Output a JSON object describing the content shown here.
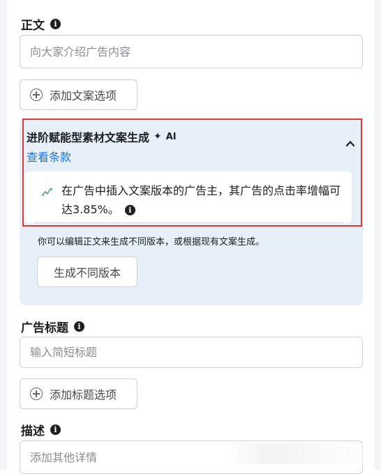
{
  "body_field": {
    "label": "正文",
    "placeholder": "向大家介绍广告内容",
    "add_option_label": "添加文案选项"
  },
  "ai_panel": {
    "title": "进阶赋能型素材文案生成",
    "ai_badge": "AI",
    "terms_link": "查看条款",
    "stat_text": "在广告中插入文案版本的广告主，其广告的点击率增幅可达3.85%。",
    "description": "你可以编辑正文来生成不同版本，或根据现有文案生成。",
    "generate_button": "生成不同版本"
  },
  "headline_field": {
    "label": "广告标题",
    "placeholder": "输入简短标题",
    "add_option_label": "添加标题选项"
  },
  "description_field": {
    "label": "描述",
    "placeholder": "添加其他详情"
  },
  "icons": {
    "info": "info-icon",
    "plus": "plus-circle-icon",
    "sparkle": "sparkle-icon",
    "chevron": "chevron-up-icon",
    "trend": "trend-up-icon"
  },
  "colors": {
    "link": "#1b74e4",
    "panel_background": "#e7f0f8",
    "highlight_border": "#d93a3a"
  }
}
